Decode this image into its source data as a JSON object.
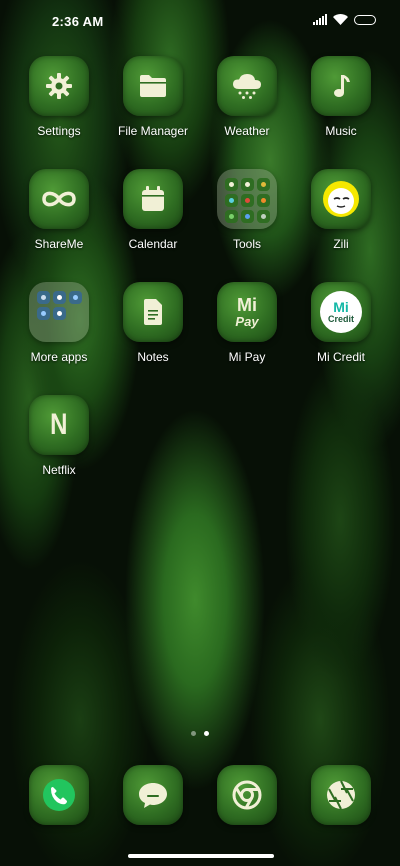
{
  "status_bar": {
    "time": "2:36 AM"
  },
  "apps": [
    {
      "id": "settings",
      "label": "Settings",
      "icon": "gear-icon"
    },
    {
      "id": "file-manager",
      "label": "File Manager",
      "icon": "folder-icon"
    },
    {
      "id": "weather",
      "label": "Weather",
      "icon": "snow-cloud-icon"
    },
    {
      "id": "music",
      "label": "Music",
      "icon": "music-note-icon"
    },
    {
      "id": "shareme",
      "label": "ShareMe",
      "icon": "infinity-icon"
    },
    {
      "id": "calendar",
      "label": "Calendar",
      "icon": "calendar-icon"
    },
    {
      "id": "tools",
      "label": "Tools",
      "icon": "folder-grid-icon"
    },
    {
      "id": "zili",
      "label": "Zili",
      "icon": "zili-face-icon"
    },
    {
      "id": "more-apps",
      "label": "More apps",
      "icon": "folder-grid-icon"
    },
    {
      "id": "notes",
      "label": "Notes",
      "icon": "note-icon"
    },
    {
      "id": "mi-pay",
      "label": "Mi Pay",
      "icon": "mi-pay-icon"
    },
    {
      "id": "mi-credit",
      "label": "Mi Credit",
      "icon": "mi-credit-icon"
    },
    {
      "id": "netflix",
      "label": "Netflix",
      "icon": "netflix-n-icon"
    }
  ],
  "logos": {
    "mi_pay_top": "Mi",
    "mi_pay_bottom": "Pay",
    "mi_credit_top": "Mi",
    "mi_credit_bottom": "Credit",
    "netflix": "N"
  },
  "dock": [
    {
      "id": "phone",
      "icon": "phone-icon",
      "color": "#22c55e"
    },
    {
      "id": "messages",
      "icon": "message-bubble-icon"
    },
    {
      "id": "browser",
      "icon": "chrome-icon"
    },
    {
      "id": "camera",
      "icon": "camera-aperture-icon"
    }
  ],
  "page_indicator": {
    "pages": 2,
    "current": 2
  }
}
